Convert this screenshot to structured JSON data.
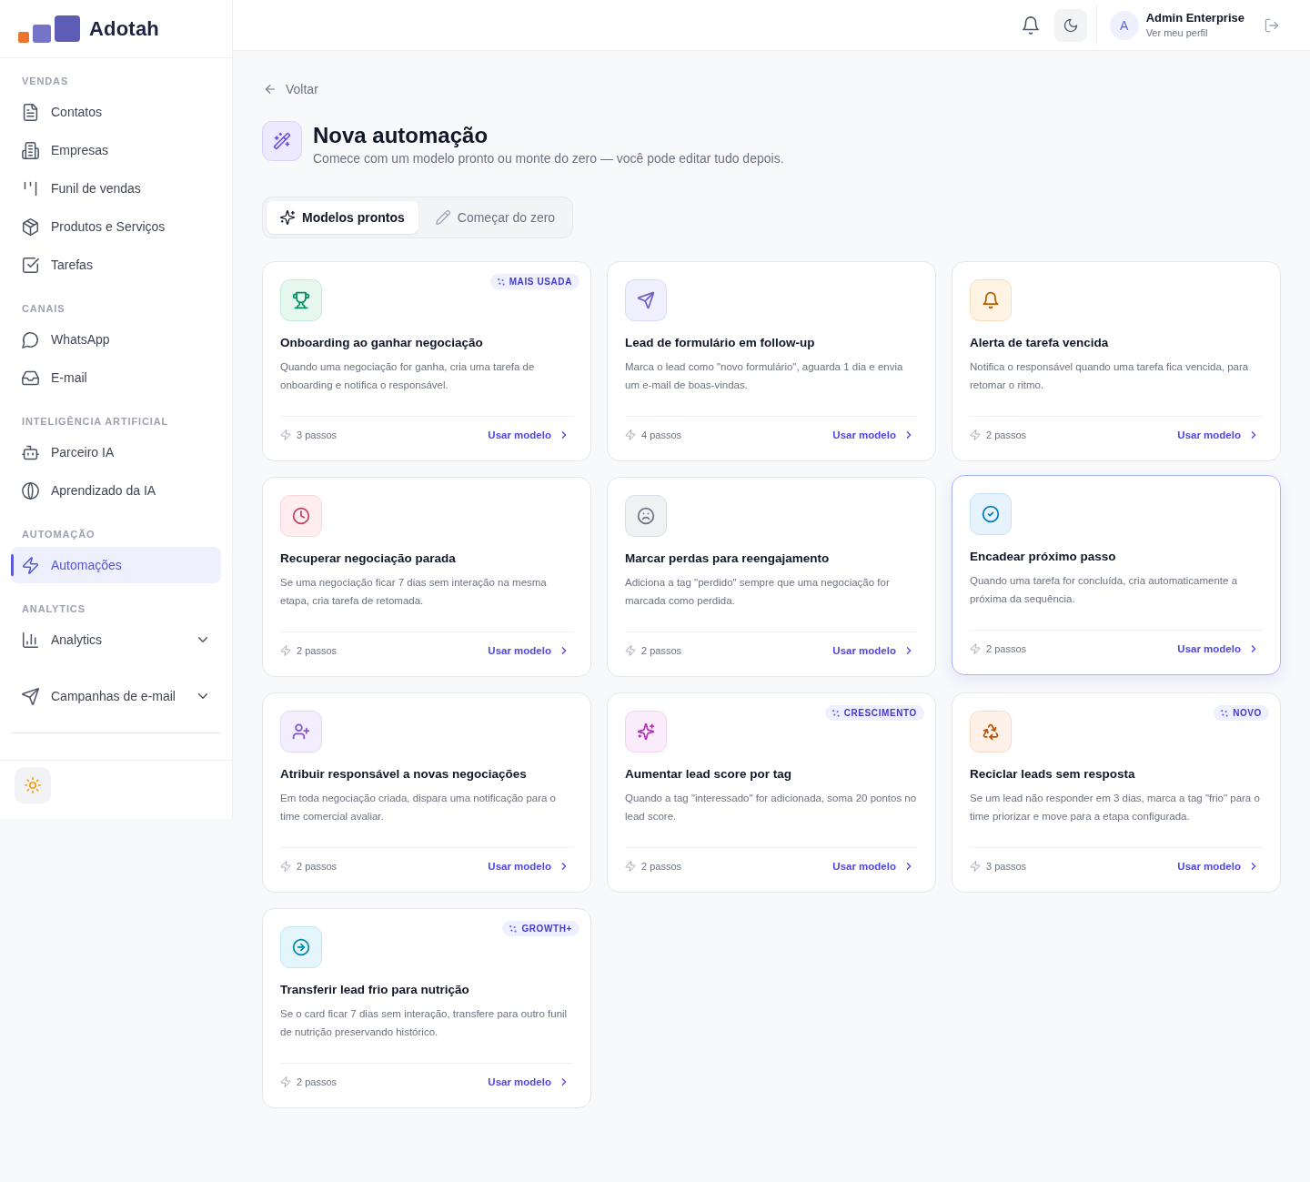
{
  "sidebar": {
    "brand": "Adotah",
    "sections": [
      {
        "title": "VENDAS",
        "items": [
          {
            "label": "Contatos",
            "kind": "link",
            "selected": false
          },
          {
            "label": "Empresas",
            "kind": "link",
            "selected": false
          },
          {
            "label": "Funil de vendas",
            "kind": "link",
            "selected": false
          },
          {
            "label": "Produtos e Serviços",
            "kind": "link",
            "selected": false
          },
          {
            "label": "Tarefas",
            "kind": "link",
            "selected": false
          }
        ]
      },
      {
        "title": "CANAIS",
        "items": [
          {
            "label": "WhatsApp",
            "kind": "link",
            "selected": false
          },
          {
            "label": "E-mail",
            "kind": "link",
            "selected": false
          }
        ]
      },
      {
        "title": "INTELIGÊNCIA ARTIFICIAL",
        "items": [
          {
            "label": "Parceiro IA",
            "kind": "link",
            "selected": false
          },
          {
            "label": "Aprendizado da IA",
            "kind": "link",
            "selected": false
          }
        ]
      },
      {
        "title": "AUTOMAÇÃO",
        "items": [
          {
            "label": "Automações",
            "kind": "link",
            "selected": true
          }
        ]
      },
      {
        "title": "ANALYTICS",
        "items": [
          {
            "label": "Analytics",
            "kind": "group",
            "selected": false,
            "expanded": false
          },
          {
            "label": "Campanhas de e-mail",
            "kind": "group",
            "selected": false,
            "expanded": false
          }
        ]
      }
    ]
  },
  "header": {
    "user": {
      "initial": "A",
      "name": "Admin Enterprise",
      "subtitle": "Ver meu perfil"
    }
  },
  "page": {
    "back": "Voltar",
    "title": "Nova automação",
    "subtitle": "Comece com um modelo pronto ou monte do zero — você pode editar tudo depois.",
    "tabs": [
      {
        "label": "Modelos prontos",
        "selected": true
      },
      {
        "label": "Começar do zero",
        "selected": false
      }
    ]
  },
  "cards": [
    {
      "title": "Onboarding ao ganhar negociação",
      "description": "Quando uma negociação for ganha, cria uma tarefa de onboarding e notifica o responsável.",
      "steps": "3 passos",
      "action": "Usar modelo",
      "badge": "MAIS USADA",
      "color": "#e6f7ef",
      "hovered": false
    },
    {
      "title": "Lead de formulário em follow-up",
      "description": "Marca o lead como \"novo formulário\", aguarda 1 dia e envia um e-mail de boas-vindas.",
      "steps": "4 passos",
      "action": "Usar modelo",
      "color": "#f0effd",
      "hovered": false
    },
    {
      "title": "Alerta de tarefa vencida",
      "description": "Notifica o responsável quando uma tarefa fica vencida, para retomar o ritmo.",
      "steps": "2 passos",
      "action": "Usar modelo",
      "color": "#fff3e3",
      "hovered": false
    },
    {
      "title": "Recuperar negociação parada",
      "description": "Se uma negociação ficar 7 dias sem interação na mesma etapa, cria tarefa de retomada.",
      "steps": "2 passos",
      "action": "Usar modelo",
      "color": "#ffedf0",
      "hovered": false
    },
    {
      "title": "Marcar perdas para reengajamento",
      "description": "Adiciona a tag \"perdido\" sempre que uma negociação for marcada como perdida.",
      "steps": "2 passos",
      "action": "Usar modelo",
      "color": "#f0f1f3",
      "hovered": false
    },
    {
      "title": "Encadear próximo passo",
      "description": "Quando uma tarefa for concluída, cria automaticamente a próxima da sequência.",
      "steps": "2 passos",
      "action": "Usar modelo",
      "color": "#e6f3fc",
      "hovered": true
    },
    {
      "title": "Atribuir responsável a novas negociações",
      "description": "Em toda negociação criada, dispara uma notificação para o time comercial avaliar.",
      "steps": "2 passos",
      "action": "Usar modelo",
      "color": "#f2eefe",
      "hovered": false
    },
    {
      "title": "Aumentar lead score por tag",
      "description": "Quando a tag \"interessado\" for adicionada, soma 20 pontos no lead score.",
      "steps": "2 passos",
      "action": "Usar modelo",
      "badge": "CRESCIMENTO",
      "color": "#fbecfb",
      "hovered": false
    },
    {
      "title": "Reciclar leads sem resposta",
      "description": "Se um lead não responder em 3 dias, marca a tag \"frio\" para o time priorizar e move para a etapa configurada.",
      "steps": "3 passos",
      "action": "Usar modelo",
      "badge": "NOVO",
      "color": "#fff0e8",
      "hovered": false
    },
    {
      "title": "Transferir lead frio para nutrição",
      "description": "Se o card ficar 7 dias sem interação, transfere para outro funil de nutrição preservando histórico.",
      "steps": "2 passos",
      "action": "Usar modelo",
      "badge": "GROWTH+",
      "color": "#e4f6fb",
      "hovered": false
    }
  ]
}
